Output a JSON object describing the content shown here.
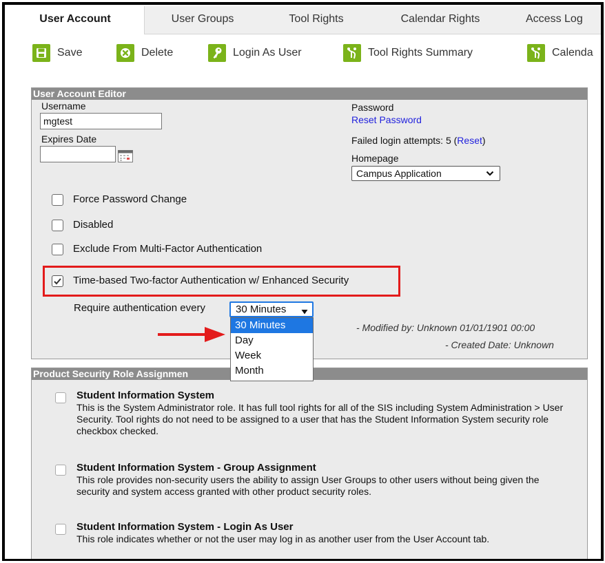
{
  "tabs": [
    "User Account",
    "User Groups",
    "Tool Rights",
    "Calendar Rights",
    "Access Log"
  ],
  "toolbar": {
    "save": "Save",
    "delete": "Delete",
    "login_as_user": "Login As User",
    "tool_rights_summary": "Tool Rights Summary",
    "calendar": "Calenda"
  },
  "editor": {
    "title": "User Account Editor",
    "username_label": "Username",
    "username_value": "mgtest",
    "expires_label": "Expires Date",
    "expires_value": "",
    "password_label": "Password",
    "reset_password": "Reset Password",
    "failed_login_prefix": "Failed login attempts: 5 (",
    "failed_login_reset": "Reset",
    "failed_login_suffix": ")",
    "homepage_label": "Homepage",
    "homepage_value": "Campus Application",
    "checkboxes": [
      {
        "label": "Force Password Change",
        "checked": false
      },
      {
        "label": "Disabled",
        "checked": false
      },
      {
        "label": "Exclude From Multi-Factor Authentication",
        "checked": false
      },
      {
        "label": "Time-based Two-factor Authentication w/ Enhanced Security",
        "checked": true
      }
    ],
    "require_auth_label": "Require authentication every",
    "require_auth_value": "30 Minutes",
    "require_auth_options": [
      "30 Minutes",
      "Day",
      "Week",
      "Month"
    ],
    "modified_by": "- Modified by: Unknown 01/01/1901 00:00",
    "created_date": "- Created Date: Unknown"
  },
  "roles": {
    "title": "Product Security Role Assignmen",
    "items": [
      {
        "title": "Student Information System",
        "desc": "This is the System Administrator role. It has full tool rights for all of the SIS including System Administration > User Security. Tool rights do not need to be assigned to a user that has the Student Information System security role checkbox checked."
      },
      {
        "title": "Student Information System - Group Assignment",
        "desc": "This role provides non-security users the ability to assign User Groups to other users without being given the security and system access granted with other product security roles."
      },
      {
        "title": "Student Information System - Login As User",
        "desc": "This role indicates whether or not the user may log in as another user from the User Account tab."
      }
    ]
  },
  "colors": {
    "accent_green": "#7bb31a",
    "highlight_red": "#e31b1b",
    "selected_blue": "#1e77e2",
    "panel_header": "#8c8c8c"
  }
}
